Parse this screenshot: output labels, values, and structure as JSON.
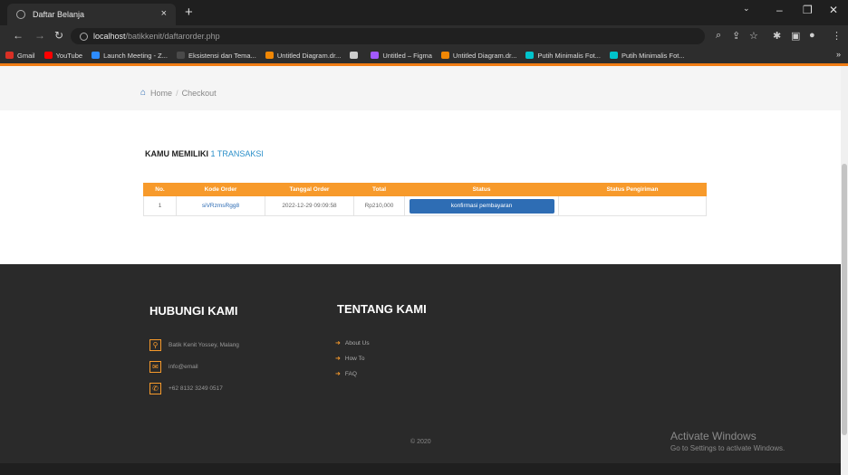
{
  "browser": {
    "tab_title": "Daftar Belanja",
    "tab_close": "×",
    "new_tab": "+",
    "url_host": "localhost",
    "url_path": "/batikkenit/daftarorder.php",
    "minimize": "–",
    "restore": "❐",
    "close": "✕",
    "bookmarks": [
      {
        "label": "Gmail",
        "color": "#d93025"
      },
      {
        "label": "YouTube",
        "color": "#ff0000"
      },
      {
        "label": "Launch Meeting - Z...",
        "color": "#2d8cff"
      },
      {
        "label": "Eksistensi dan Tema...",
        "color": "#4a4a4a"
      },
      {
        "label": "Untitled Diagram.dr...",
        "color": "#f08705"
      },
      {
        "label": "",
        "color": "#cccccc"
      },
      {
        "label": "Untitled – Figma",
        "color": "#a259ff"
      },
      {
        "label": "Untitled Diagram.dr...",
        "color": "#f08705"
      },
      {
        "label": "Putih Minimalis Fot...",
        "color": "#00c4cc"
      },
      {
        "label": "Putih Minimalis Fot...",
        "color": "#00c4cc"
      }
    ],
    "bookmarks_more": "»"
  },
  "breadcrumb": {
    "home": "Home",
    "separator": "/",
    "current": "Checkout"
  },
  "orders": {
    "title_prefix": "KAMU MEMILIKI",
    "count_text": "1 TRANSAKSI",
    "columns": [
      "No.",
      "Kode Order",
      "Tanggal Order",
      "Total",
      "Status",
      "Status Pengiriman"
    ],
    "rows": [
      {
        "no": "1",
        "code": "siVRzmsRgg8",
        "date": "2022-12-29 09:09:58",
        "total": "Rp210,000",
        "status_button": "konfirmasi pembayaran",
        "shipping": ""
      }
    ]
  },
  "footer": {
    "contact_heading": "HUBUNGI KAMI",
    "about_heading": "TENTANG KAMI",
    "contacts": [
      {
        "icon": "map-pin-icon",
        "text": "Batik Kenit Yossey, Malang"
      },
      {
        "icon": "mail-icon",
        "text": "info@email"
      },
      {
        "icon": "phone-icon",
        "text": "+62 8132 3249 0517"
      }
    ],
    "links": [
      "About Us",
      "How To",
      "FAQ"
    ],
    "copyright": "© 2020"
  },
  "windows_notice": {
    "title": "Activate Windows",
    "subtitle": "Go to Settings to activate Windows."
  },
  "colors": {
    "accent": "#f79a2b",
    "primary": "#2e6db4",
    "footer_bg": "#2a2a2a"
  }
}
